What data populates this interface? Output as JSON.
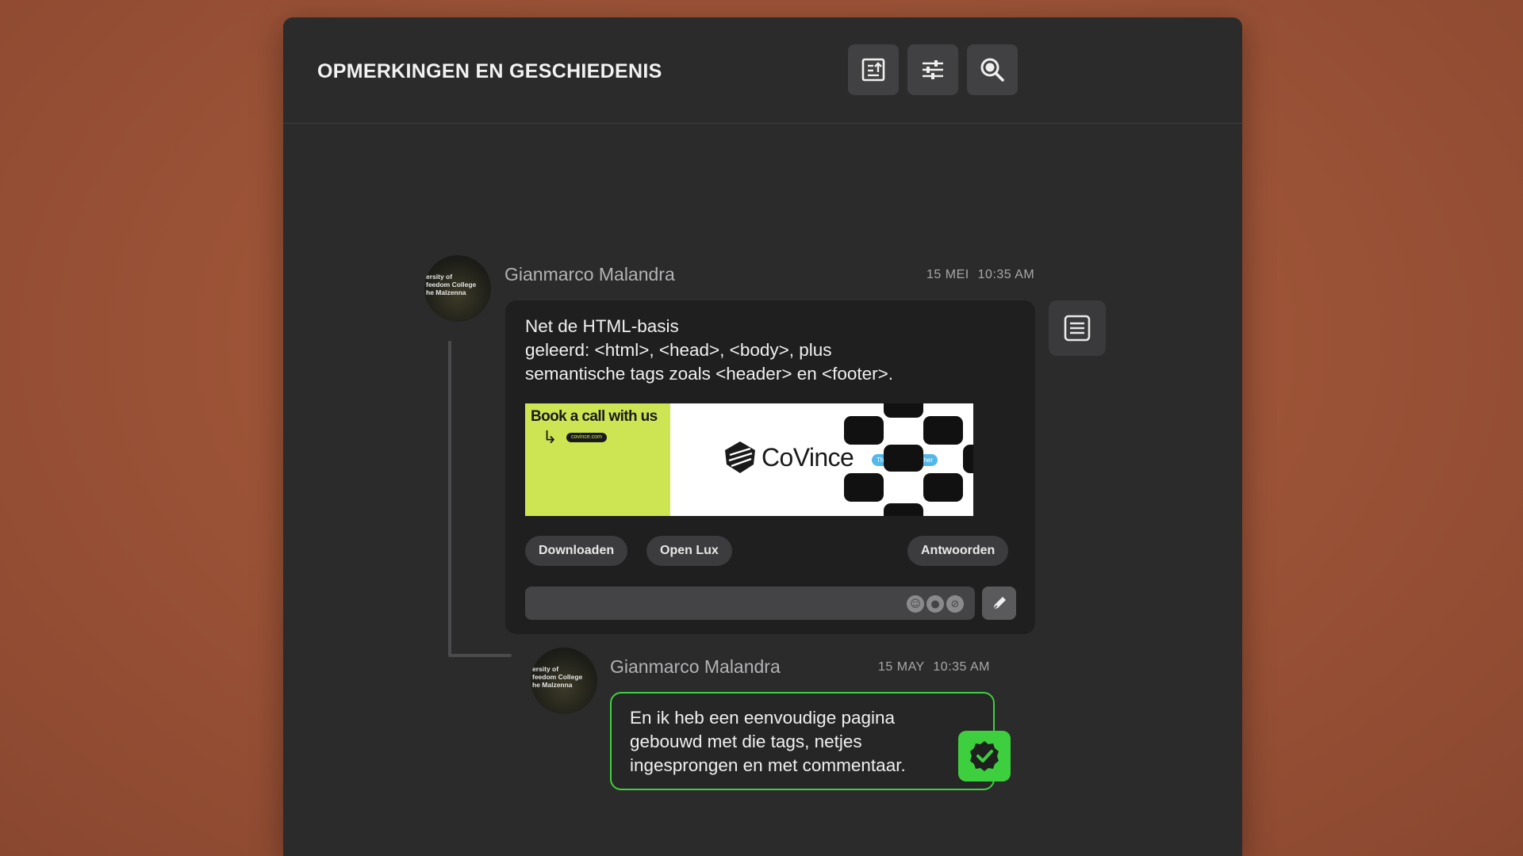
{
  "panel": {
    "title": "OPMERKINGEN EN GESCHIEDENIS",
    "toolbar": [
      {
        "icon": "export-icon"
      },
      {
        "icon": "sliders-icon"
      },
      {
        "icon": "search-icon"
      }
    ]
  },
  "comment": {
    "author": "Gianmarco Malandra",
    "date": "15 MEI",
    "time": "10:35 AM",
    "avatar_text": "ersity of\nfeedom College\nhe Malzenna",
    "text": "Net de HTML-basis\ngeleerd: <html>, <head>, <body>, plus\nsemantische tags zoals <header> en <footer>.",
    "attachment": {
      "cta": "Book a call with us",
      "url": "covince.com",
      "brand": "CoVince",
      "tagline": "Th Grone To Gether",
      "accent_color": "#cde553"
    },
    "actions": {
      "download": "Downloaden",
      "open": "Open Lux",
      "reply": "Antwoorden"
    },
    "reply_input": {
      "value": "",
      "icons": [
        "emoji-icon",
        "mention-icon",
        "attach-icon"
      ]
    }
  },
  "reply": {
    "author": "Gianmarco Malandra",
    "date": "15 MAY",
    "time": "10:35 AM",
    "avatar_text": "ersity of\nfeedom College\nhe Malzenna",
    "text": "En ik heb een eenvoudige pagina\ngebouwd met die tags, netjes\ningesprongen en met commentaar.",
    "status_color": "#3ecf3e"
  }
}
